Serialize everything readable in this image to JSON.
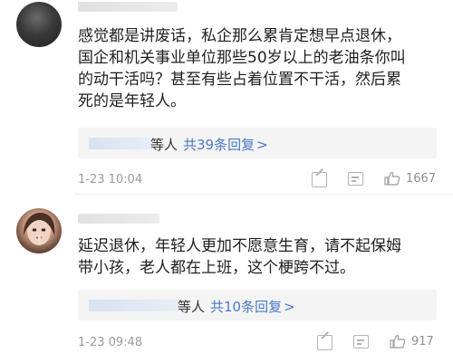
{
  "comments": [
    {
      "text": "感觉都是讲废话，私企那么累肯定想早点退休，\n国企和机关事业单位那些50岁以上的老油条你叫\n的动干活吗？甚至有些占着位置不干活，然后累\n死的是年轻人。",
      "reply_prefix": "等人",
      "reply_count": "共39条回复",
      "reply_arrow": ">",
      "timestamp": "1-23 10:04",
      "likes": "1667"
    },
    {
      "text": "延迟退休，年轻人更加不愿意生育，请不起保姆\n带小孩，老人都在上班，这个梗跨不过。",
      "reply_prefix": "等人",
      "reply_count": "共10条回复",
      "reply_arrow": ">",
      "timestamp": "1-23 09:48",
      "likes": "917"
    }
  ],
  "icons": {
    "share": "share-icon",
    "comment": "comment-icon",
    "like": "thumbs-up-icon"
  }
}
